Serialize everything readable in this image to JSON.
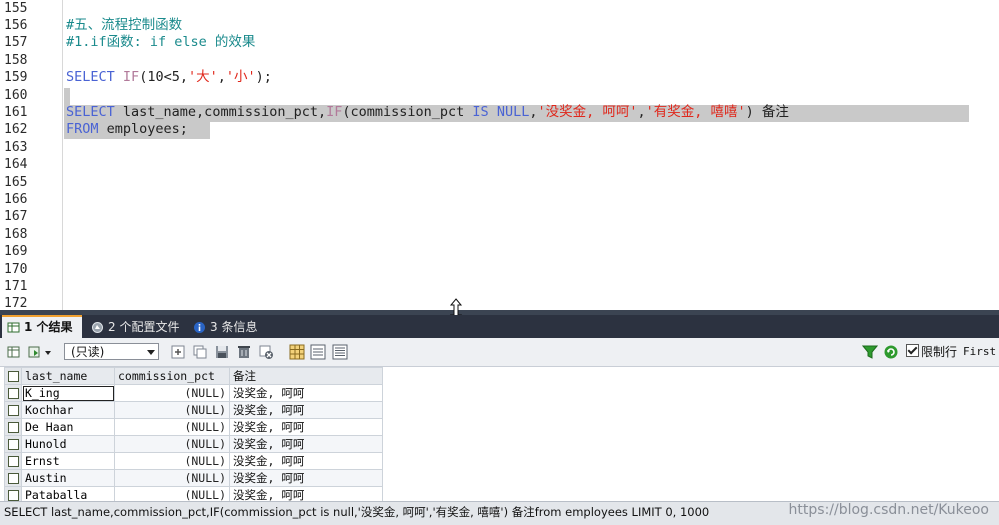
{
  "editor": {
    "line_numbers": [
      "155",
      "156",
      "157",
      "158",
      "159",
      "160",
      "161",
      "162",
      "163",
      "164",
      "165",
      "166",
      "167",
      "168",
      "169",
      "170",
      "171",
      "172"
    ],
    "line156": "#五、流程控制函数",
    "line157": "#1.if函数: if else 的效果",
    "line159": {
      "kw": "SELECT",
      "fn": "IF",
      "args": "(10<5,",
      "s1": "'大'",
      "comma": ",",
      "s2": "'小'",
      "end": ");"
    },
    "line161": {
      "kw": "SELECT",
      "cols": " last_name,commission_pct,",
      "fn": "IF",
      "arg": "(commission_pct ",
      "is": "IS",
      "null": "NULL",
      "comma1": ",",
      "s1": "'没奖金, 呵呵'",
      "comma2": ",",
      "s2": "'有奖金, 嘻嘻'",
      "end": ") 备注"
    },
    "line162": {
      "kw": "FROM",
      "rest": " employees;"
    }
  },
  "tabs": [
    {
      "label": "1 个结果",
      "icon": "result-grid-icon"
    },
    {
      "label": "2 个配置文件",
      "icon": "profile-icon"
    },
    {
      "label": "3 条信息",
      "icon": "info-icon"
    }
  ],
  "toolbar": {
    "mode_select": "(只读)",
    "limit_label": "限制行",
    "first_label": "First"
  },
  "grid": {
    "columns": [
      "last_name",
      "commission_pct",
      "备注"
    ],
    "rows": [
      [
        "K_ing",
        "(NULL)",
        "没奖金, 呵呵"
      ],
      [
        "Kochhar",
        "(NULL)",
        "没奖金, 呵呵"
      ],
      [
        "De Haan",
        "(NULL)",
        "没奖金, 呵呵"
      ],
      [
        "Hunold",
        "(NULL)",
        "没奖金, 呵呵"
      ],
      [
        "Ernst",
        "(NULL)",
        "没奖金, 呵呵"
      ],
      [
        "Austin",
        "(NULL)",
        "没奖金, 呵呵"
      ],
      [
        "Pataballa",
        "(NULL)",
        "没奖金, 呵呵"
      ]
    ]
  },
  "status": {
    "query": "SELECT last_name,commission_pct,IF(commission_pct is null,'没奖金, 呵呵','有奖金, 嘻嘻') 备注from employees LIMIT 0, 1000",
    "watermark": "https://blog.csdn.net/Kukeoo"
  },
  "colors": {
    "keyword": "#4a63d4",
    "string": "#e0271b",
    "comment": "#1a8a8c",
    "selection": "#c9c9c9",
    "tab_bar": "#2c3240"
  }
}
